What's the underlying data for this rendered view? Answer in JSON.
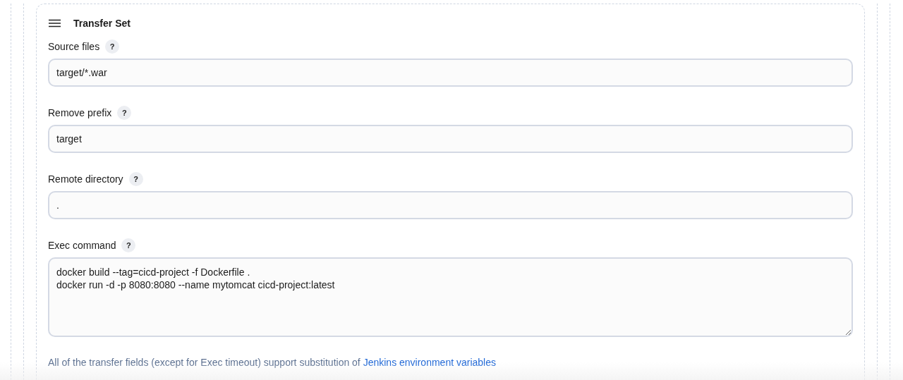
{
  "section": {
    "title": "Transfer Set"
  },
  "fields": [
    {
      "label": "Source files",
      "help": "?",
      "kind": "input",
      "value": "target/*.war"
    },
    {
      "label": "Remove prefix",
      "help": "?",
      "kind": "input",
      "value": "target"
    },
    {
      "label": "Remote directory",
      "help": "?",
      "kind": "input",
      "value": "."
    },
    {
      "label": "Exec command",
      "help": "?",
      "kind": "textarea",
      "value": "docker build --tag=cicd-project -f Dockerfile .\ndocker run -d -p 8080:8080 --name mytomcat cicd-project:latest"
    }
  ],
  "footer": {
    "text": "All of the transfer fields (except for Exec timeout) support substitution of",
    "link": "Jenkins environment variables"
  }
}
